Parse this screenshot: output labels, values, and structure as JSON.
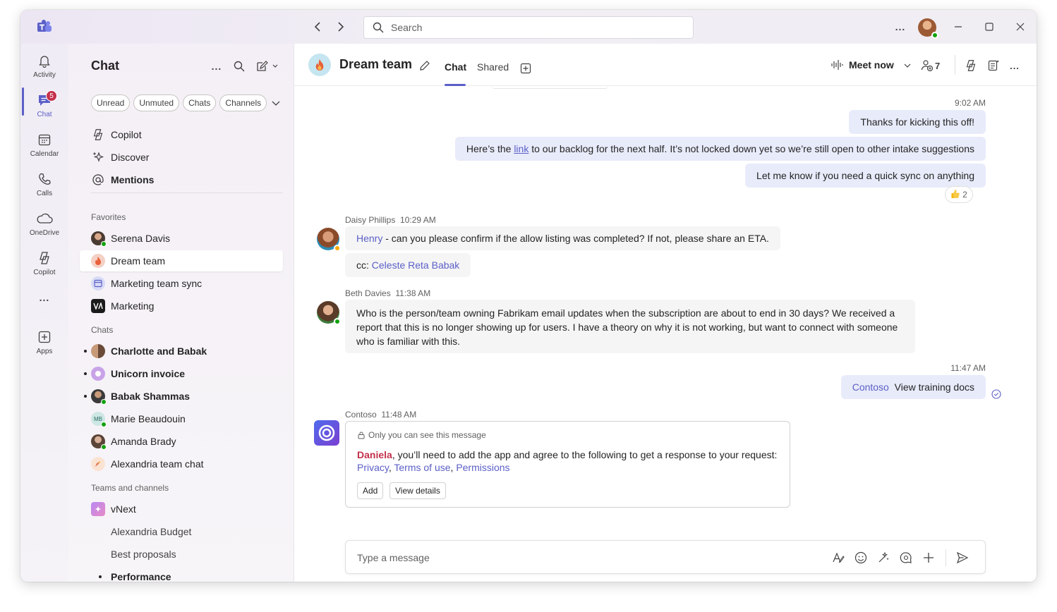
{
  "titlebar": {
    "search_placeholder": "Search",
    "more_label": "...",
    "icons": [
      "teams-logo",
      "back-arrow",
      "forward-arrow",
      "search-icon",
      "more-icon",
      "minimize-icon",
      "maximize-icon",
      "close-icon"
    ]
  },
  "rail": {
    "items": [
      {
        "label": "Activity",
        "icon": "bell-icon"
      },
      {
        "label": "Chat",
        "icon": "chat-icon",
        "badge": "5",
        "active": true
      },
      {
        "label": "Calendar",
        "icon": "calendar-icon"
      },
      {
        "label": "Calls",
        "icon": "phone-icon"
      },
      {
        "label": "OneDrive",
        "icon": "cloud-icon"
      },
      {
        "label": "Copilot",
        "icon": "copilot-icon"
      },
      {
        "label": "...",
        "icon": "more-icon"
      },
      {
        "label": "Apps",
        "icon": "add-app-icon"
      }
    ]
  },
  "chatlist": {
    "title": "Chat",
    "filters": [
      "Unread",
      "Unmuted",
      "Chats",
      "Channels"
    ],
    "top_items": [
      {
        "label": "Copilot",
        "icon": "copilot-icon"
      },
      {
        "label": "Discover",
        "icon": "sparkle-icon"
      },
      {
        "label": "Mentions",
        "icon": "at-icon"
      }
    ],
    "favorites_label": "Favorites",
    "favorites": [
      {
        "label": "Serena Davis"
      },
      {
        "label": "Dream team",
        "selected": true
      },
      {
        "label": "Marketing team sync"
      },
      {
        "label": "Marketing"
      }
    ],
    "chats_label": "Chats",
    "chats": [
      {
        "label": "Charlotte and Babak",
        "unread": true
      },
      {
        "label": "Unicorn invoice",
        "unread": true
      },
      {
        "label": "Babak Shammas",
        "unread": true
      },
      {
        "label": "Marie Beaudouin",
        "initials": "MB"
      },
      {
        "label": "Amanda Brady"
      },
      {
        "label": "Alexandria team chat"
      }
    ],
    "teams_label": "Teams and channels",
    "teams": [
      {
        "label": "vNext"
      },
      {
        "label": "Alexandria Budget"
      },
      {
        "label": "Best proposals"
      },
      {
        "label": "Performance",
        "unread": true
      }
    ]
  },
  "header": {
    "team_name": "Dream team",
    "tabs": [
      "Chat",
      "Shared"
    ],
    "meet_now": "Meet now",
    "participants": "7"
  },
  "messages": {
    "ts_1": "9:02 AM",
    "me_1": "Thanks for kicking this off!",
    "me_2_pre": "Here’s the ",
    "me_2_link": "link",
    "me_2_post": " to our backlog for the next half. It’s not locked down yet so we’re still open to other intake suggestions",
    "me_3": "Let me know if you need a quick sync on anything",
    "reaction_count": "2",
    "daisy_name": "Daisy Phillips",
    "daisy_time": "10:29 AM",
    "daisy_mention": "Henry",
    "daisy_text": " - can you please confirm if the allow listing was completed? If not, please share an ETA.",
    "daisy_cc": "cc: ",
    "daisy_cc_mention": "Celeste Reta Babak",
    "beth_name": "Beth Davies",
    "beth_time": "11:38 AM",
    "beth_text": "Who is the person/team owning Fabrikam email updates when the subscription are about to end in 30 days? We received a report that this is no longer showing up for users. I have a theory on why it is not working, but want to connect with someone who is familiar with this.",
    "ts_2": "11:47 AM",
    "me_4_mention": "Contoso",
    "me_4_text": "  View training docs",
    "contoso_name": "Contoso",
    "contoso_time": "11:48 AM",
    "card_private": "Only you can see this message",
    "card_mention": "Daniela",
    "card_text": ", you’ll need to add the app and agree to the following to get a response to your request:",
    "card_link_1": "Privacy",
    "card_link_2": "Terms of use",
    "card_link_3": "Permissions",
    "card_sep": ", ",
    "card_btn_add": "Add",
    "card_btn_details": "View details"
  },
  "compose": {
    "placeholder": "Type a message"
  },
  "colors": {
    "accent": "#5b5fc7",
    "bubble_me": "#e8ebfa",
    "mention_me": "#c4314b",
    "presence": "#13a10e",
    "badge": "#c4314b"
  }
}
